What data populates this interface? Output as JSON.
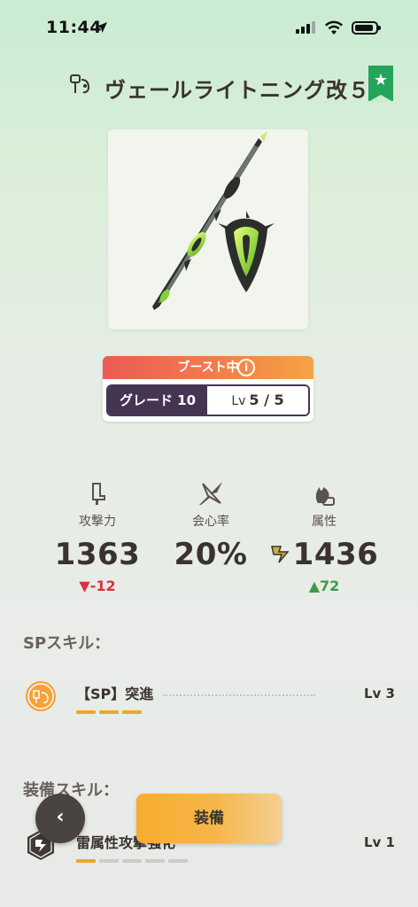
{
  "status_bar": {
    "time": "11:44"
  },
  "header": {
    "weapon_name": "ヴェールライトニング改５",
    "weapon_type_icon": "hammer-icon",
    "bookmark_icon": "star-bookmark-icon"
  },
  "boost": {
    "label": "ブースト中",
    "info_glyph": "i"
  },
  "grade": {
    "label": "グレード 10",
    "level_prefix": "Lv",
    "level": "5 / 5"
  },
  "stats": {
    "attack": {
      "label": "攻撃力",
      "value": "1363",
      "delta": "▼-12",
      "icon": "attack-icon"
    },
    "critical": {
      "label": "会心率",
      "value": "20%",
      "icon": "critical-icon"
    },
    "element": {
      "label": "属性",
      "value": "1436",
      "delta": "▲72",
      "icon": "element-icon",
      "element_type_icon": "thunder-icon"
    }
  },
  "sp_skills": {
    "title": "SPスキル：",
    "items": [
      {
        "name": "【SP】突進",
        "level": "Lv 3",
        "pips_filled": 3,
        "pips_total": 3
      }
    ]
  },
  "equip_skills": {
    "title": "装備スキル：",
    "items": [
      {
        "name": "雷属性攻撃強化",
        "level": "Lv 1",
        "pips_filled": 1,
        "pips_total": 5
      }
    ]
  },
  "buttons": {
    "back_glyph": "‹",
    "equip_label": "装備"
  },
  "colors": {
    "accent_orange": "#f8ac2d",
    "grade_purple": "#463552",
    "bookmark_green": "#24a55a",
    "delta_down": "#d8333b",
    "delta_up": "#3f9a48"
  }
}
